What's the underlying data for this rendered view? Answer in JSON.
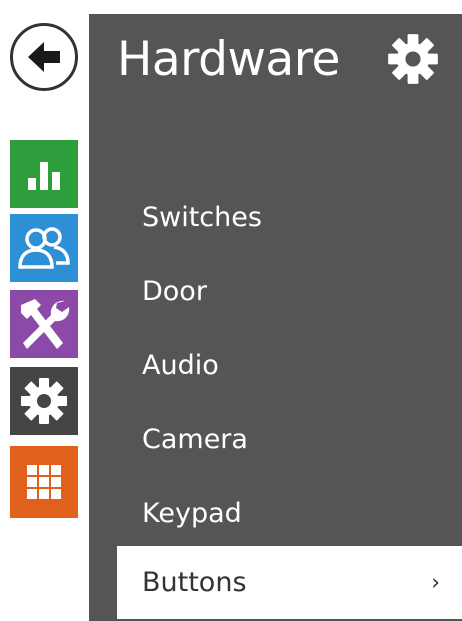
{
  "header": {
    "title": "Hardware"
  },
  "nav": {
    "back_icon": "arrow-left-icon",
    "tiles": [
      {
        "name": "status",
        "icon": "bar-chart-icon",
        "color": "#2e9e3c"
      },
      {
        "name": "directory",
        "icon": "users-icon",
        "color": "#2d8fd5"
      },
      {
        "name": "services",
        "icon": "tools-icon",
        "color": "#8c4aa8"
      },
      {
        "name": "hardware",
        "icon": "gear-icon",
        "color": "#454545"
      },
      {
        "name": "system",
        "icon": "grid-icon",
        "color": "#e1601b"
      }
    ]
  },
  "menu": {
    "items": [
      {
        "label": "Switches"
      },
      {
        "label": "Door"
      },
      {
        "label": "Audio"
      },
      {
        "label": "Camera"
      },
      {
        "label": "Keypad"
      },
      {
        "label": "Buttons",
        "active": true,
        "chevron": "›"
      }
    ]
  },
  "colors": {
    "panel": "#555555",
    "active_bg": "#ffffff",
    "active_text": "#333333"
  }
}
